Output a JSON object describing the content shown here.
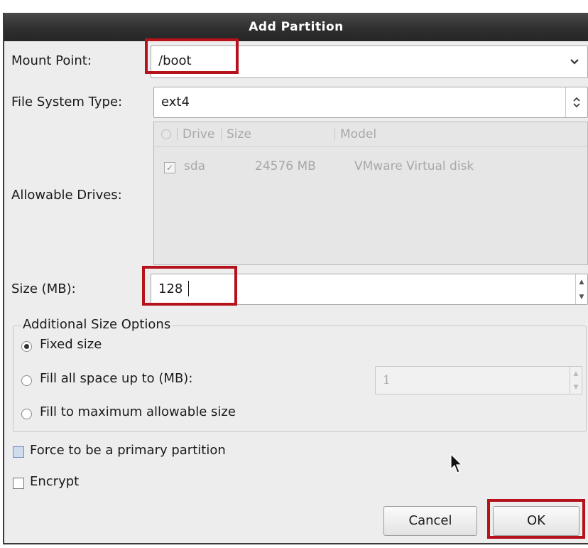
{
  "dialog": {
    "title": "Add Partition",
    "mount_point": {
      "label": "Mount Point:",
      "value": "/boot"
    },
    "fs_type": {
      "label": "File System Type:",
      "value": "ext4"
    },
    "drives": {
      "label": "Allowable Drives:",
      "columns": [
        "Drive",
        "Size",
        "Model"
      ],
      "rows": [
        {
          "checked": true,
          "drive": "sda",
          "size": "24576 MB",
          "model": "VMware Virtual disk"
        }
      ]
    },
    "size": {
      "label": "Size (MB):",
      "value": "128"
    },
    "options": {
      "legend": "Additional Size Options",
      "fixed": "Fixed size",
      "fill_up_to": "Fill all space up to (MB):",
      "fill_up_to_value": "1",
      "fill_max": "Fill to maximum allowable size",
      "selected": "fixed"
    },
    "primary_label": "Force to be a primary partition",
    "encrypt_label": "Encrypt",
    "cancel_label": "Cancel",
    "ok_label": "OK"
  },
  "colors": {
    "highlight": "#b5121b",
    "titlebar": "#2f2f2f"
  }
}
